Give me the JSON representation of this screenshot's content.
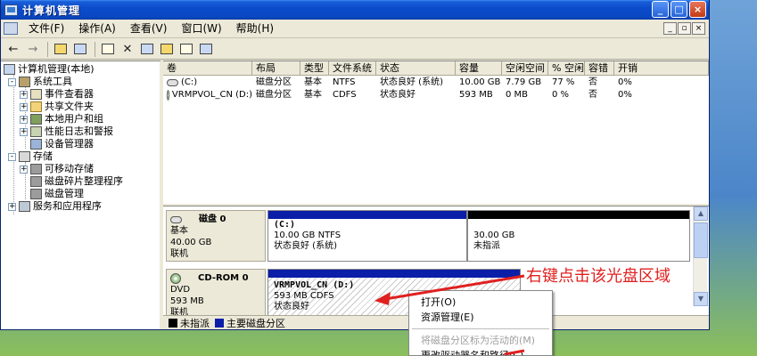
{
  "window": {
    "title": "计算机管理",
    "controls": {
      "minimize": "_",
      "maximize": "□",
      "close": "×"
    }
  },
  "menu": {
    "items": [
      "文件(F)",
      "操作(A)",
      "查看(V)",
      "窗口(W)",
      "帮助(H)"
    ],
    "mdi_controls": [
      "_",
      "▫",
      "×"
    ]
  },
  "toolbar": {
    "back": "←",
    "forward": "→"
  },
  "tree": {
    "root": "计算机管理(本地)",
    "system_tools": "系统工具",
    "event_viewer": "事件查看器",
    "shared_folders": "共享文件夹",
    "local_users": "本地用户和组",
    "perf_logs": "性能日志和警报",
    "device_manager": "设备管理器",
    "storage": "存储",
    "removable": "可移动存储",
    "defrag": "磁盘碎片整理程序",
    "disk_mgmt": "磁盘管理",
    "services": "服务和应用程序",
    "expanded": "-",
    "collapsed": "+"
  },
  "volume_list": {
    "columns": [
      "卷",
      "布局",
      "类型",
      "文件系统",
      "状态",
      "容量",
      "空闲空间",
      "% 空闲",
      "容错",
      "开销"
    ],
    "rows": [
      [
        "(C:)",
        "磁盘分区",
        "基本",
        "NTFS",
        "状态良好 (系统)",
        "10.00 GB",
        "7.79 GB",
        "77 %",
        "否",
        "0%"
      ],
      [
        "VRMPVOL_CN (D:)",
        "磁盘分区",
        "基本",
        "CDFS",
        "状态良好",
        "593 MB",
        "0 MB",
        "0 %",
        "否",
        "0%"
      ]
    ]
  },
  "disks": {
    "disk0": {
      "name": "磁盘 0",
      "type": "基本",
      "size": "40.00 GB",
      "status": "联机",
      "partitions": [
        {
          "title": "(C:)",
          "detail": "10.00 GB NTFS",
          "status": "状态良好 (系统)"
        },
        {
          "title": "",
          "detail": "30.00 GB",
          "status": "未指派"
        }
      ]
    },
    "cdrom0": {
      "name": "CD-ROM 0",
      "type": "DVD",
      "size": "593 MB",
      "status": "联机",
      "partition": {
        "title": "VRMPVOL_CN (D:)",
        "detail": "593 MB CDFS",
        "status": "状态良好"
      }
    },
    "legend": [
      "未指派",
      "主要磁盘分区"
    ],
    "colors": {
      "unallocated": "#000000",
      "primary": "#0a1ea8"
    }
  },
  "context_menu": {
    "items": [
      "打开(O)",
      "资源管理(E)",
      "将磁盘分区标为活动的(M)",
      "更改驱动器名和路径(C)..."
    ]
  },
  "annotation": {
    "text": "右键点击该光盘区域",
    "color": "#e02020"
  }
}
